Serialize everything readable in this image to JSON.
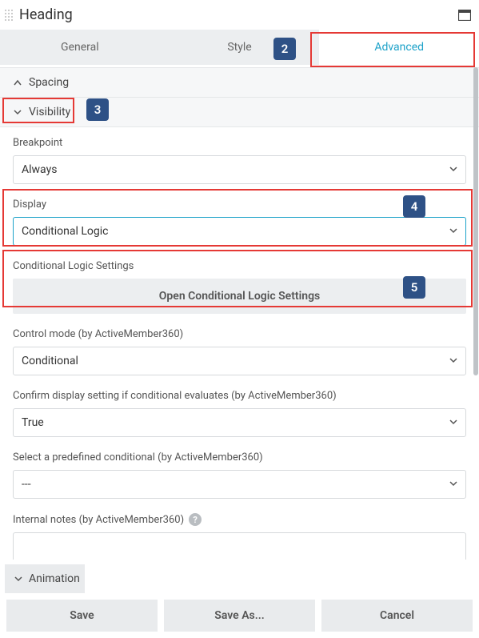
{
  "header": {
    "title": "Heading"
  },
  "tabs": {
    "general": "General",
    "style": "Style",
    "advanced": "Advanced"
  },
  "sections": {
    "spacing": {
      "label": "Spacing"
    },
    "visibility": {
      "label": "Visibility",
      "breakpoint": {
        "label": "Breakpoint",
        "value": "Always"
      },
      "display": {
        "label": "Display",
        "value": "Conditional Logic"
      },
      "cls": {
        "label": "Conditional Logic Settings",
        "button": "Open Conditional Logic Settings"
      },
      "control_mode": {
        "label": "Control mode (by ActiveMember360)",
        "value": "Conditional"
      },
      "confirm": {
        "label": "Confirm display setting if conditional evaluates (by ActiveMember360)",
        "value": "True"
      },
      "predefined": {
        "label": "Select a predefined conditional (by ActiveMember360)",
        "value": "---"
      },
      "notes": {
        "label": "Internal notes (by ActiveMember360)",
        "value": ""
      }
    },
    "animation": {
      "label": "Animation"
    }
  },
  "footer": {
    "save": "Save",
    "saveas": "Save As...",
    "cancel": "Cancel"
  },
  "callouts": {
    "two": "2",
    "three": "3",
    "four": "4",
    "five": "5"
  }
}
